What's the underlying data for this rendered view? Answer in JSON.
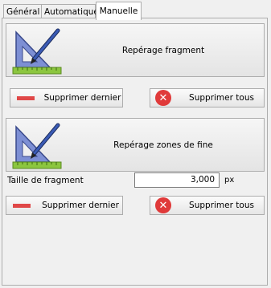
{
  "tabs": [
    {
      "label": "Général",
      "active": false
    },
    {
      "label": "Automatique",
      "active": false
    },
    {
      "label": "Manuelle",
      "active": true
    }
  ],
  "manual": {
    "fragment_button_label": "Repérage fragment",
    "zones_button_label": "Repérage zones de fine",
    "delete_last_label": "Supprimer dernier",
    "delete_all_label": "Supprimer tous",
    "fragment_size_label": "Taille de fragment",
    "fragment_size_value": "3,000",
    "fragment_size_unit": "px"
  },
  "colors": {
    "delete_icon": "#e03a3a",
    "ruler_green": "#8cc63f",
    "triangle_blue": "#5b6fb8"
  },
  "icons": {
    "measure_tool": "ruler-triangle-pen-icon",
    "delete_last": "minus-icon",
    "delete_all": "x-circle-icon"
  }
}
